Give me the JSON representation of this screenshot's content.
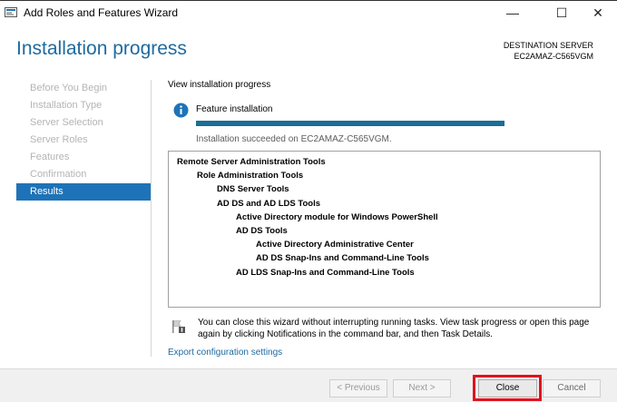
{
  "window": {
    "title": "Add Roles and Features Wizard",
    "controls": {
      "minimize": "—",
      "maximize": "☐",
      "close": "✕"
    }
  },
  "header": {
    "title": "Installation progress",
    "destination_label": "DESTINATION SERVER",
    "destination_server": "EC2AMAZ-C565VGM"
  },
  "nav": {
    "items": [
      {
        "label": "Before You Begin",
        "active": false
      },
      {
        "label": "Installation Type",
        "active": false
      },
      {
        "label": "Server Selection",
        "active": false
      },
      {
        "label": "Server Roles",
        "active": false
      },
      {
        "label": "Features",
        "active": false
      },
      {
        "label": "Confirmation",
        "active": false
      },
      {
        "label": "Results",
        "active": true
      }
    ]
  },
  "main": {
    "view_label": "View installation progress",
    "feature_label": "Feature installation",
    "progress_percent": 100,
    "status_text": "Installation succeeded on EC2AMAZ-C565VGM.",
    "results": [
      {
        "label": "Remote Server Administration Tools",
        "level": 0
      },
      {
        "label": "Role Administration Tools",
        "level": 1
      },
      {
        "label": "DNS Server Tools",
        "level": 2
      },
      {
        "label": "AD DS and AD LDS Tools",
        "level": 2
      },
      {
        "label": "Active Directory module for Windows PowerShell",
        "level": 3
      },
      {
        "label": "AD DS Tools",
        "level": 3
      },
      {
        "label": "Active Directory Administrative Center",
        "level": 4
      },
      {
        "label": "AD DS Snap-Ins and Command-Line Tools",
        "level": 4
      },
      {
        "label": "AD LDS Snap-Ins and Command-Line Tools",
        "level": 3
      }
    ],
    "note": "You can close this wizard without interrupting running tasks. View task progress or open this page again by clicking Notifications in the command bar, and then Task Details.",
    "export_link": "Export configuration settings"
  },
  "footer": {
    "previous": "< Previous",
    "next": "Next >",
    "close": "Close",
    "cancel": "Cancel"
  },
  "colors": {
    "accent": "#1e6aa0",
    "nav_active": "#1e73b8",
    "progress": "#1b6e96",
    "highlight": "#e0131d"
  }
}
